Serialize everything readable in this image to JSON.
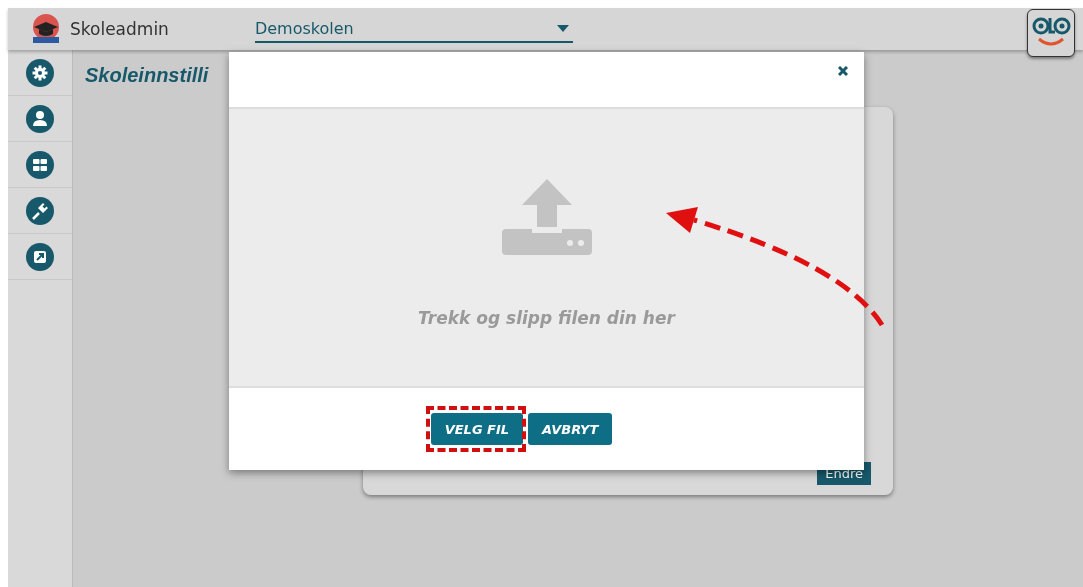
{
  "header": {
    "app_name": "Skoleadmin",
    "school_select": {
      "value": "Demoskolen"
    }
  },
  "sidebar": {
    "items": [
      {
        "selected": false
      },
      {
        "selected": false
      },
      {
        "selected": false
      },
      {
        "selected": false
      },
      {
        "selected": false
      }
    ]
  },
  "page": {
    "title": "Skoleinnstilli",
    "card": {
      "button": "Endre"
    }
  },
  "modal": {
    "dropzone_text": "Trekk og slipp filen din her",
    "buttons": [
      {
        "label": "VELG FIL",
        "highlighted": true
      },
      {
        "label": "AVBRYT",
        "highlighted": false
      }
    ]
  }
}
